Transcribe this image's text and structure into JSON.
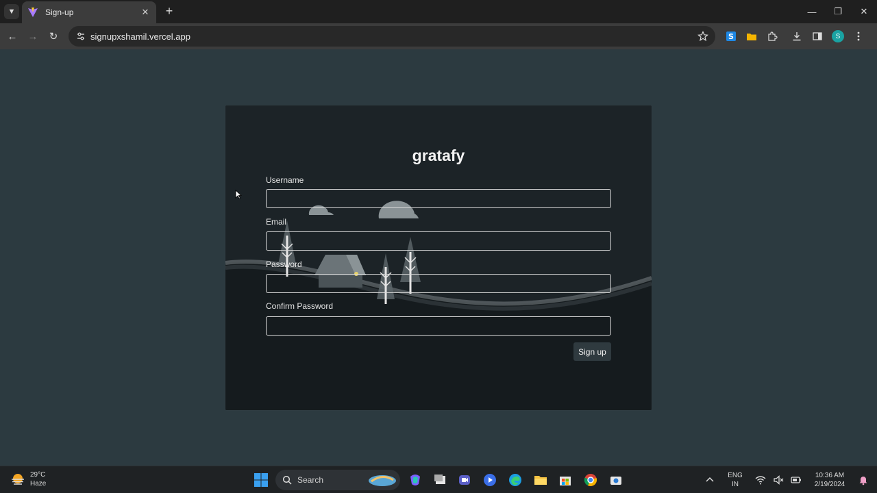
{
  "browser": {
    "tab_title": "Sign-up",
    "url": "signupxshamil.vercel.app",
    "profile_initial": "S"
  },
  "page": {
    "brand": "gratafy",
    "fields": {
      "username": {
        "label": "Username",
        "value": ""
      },
      "email": {
        "label": "Email",
        "value": ""
      },
      "password": {
        "label": "Password",
        "value": ""
      },
      "confirm": {
        "label": "Confirm Password",
        "value": ""
      }
    },
    "submit_label": "Sign up"
  },
  "taskbar": {
    "weather_temp": "29°C",
    "weather_desc": "Haze",
    "search_label": "Search",
    "lang_line1": "ENG",
    "lang_line2": "IN",
    "time": "10:36 AM",
    "date": "2/19/2024"
  },
  "colors": {
    "page_bg": "#2c3a40",
    "card_bg": "#1c2327",
    "accent_teal": "#1aa3a3"
  }
}
